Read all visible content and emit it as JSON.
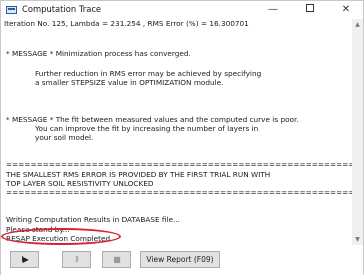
{
  "window": {
    "title": "Computation Trace",
    "minimize_glyph": "—",
    "close_glyph": "✕"
  },
  "log": {
    "lines": [
      "Iteration No.  125, Lambda = 231.254   , RMS Error (%) =   16.300701",
      "* MESSAGE * Minimization process has converged.",
      "Further reduction in RMS error may be achieved by specifying",
      "a smaller STEPSIZE value in OPTIMIZATION module.",
      "* MESSAGE * The fit between measured values and the computed curve is poor.",
      "You can improve the fit by increasing the number of layers in",
      "your soil model.",
      "=====================================================================",
      "THE SMALLEST RMS ERROR IS PROVIDED BY THE FIRST  TRIAL RUN WITH",
      "TOP LAYER SOIL RESISTIVITY UNLOCKED",
      "=====================================================================",
      "Writing Computation Results in DATABASE file...",
      "Please stand by...",
      "RESAP Execution Completed"
    ]
  },
  "controls": {
    "run_glyph": "I▶",
    "pause_glyph": "II",
    "stop_glyph": "■",
    "report_label": "View Report (F09)"
  },
  "scrollbar": {
    "up_glyph": "▲",
    "down_glyph": "▼"
  },
  "colors": {
    "highlight": "#d72631",
    "app_icon": "#2b5aa8"
  }
}
